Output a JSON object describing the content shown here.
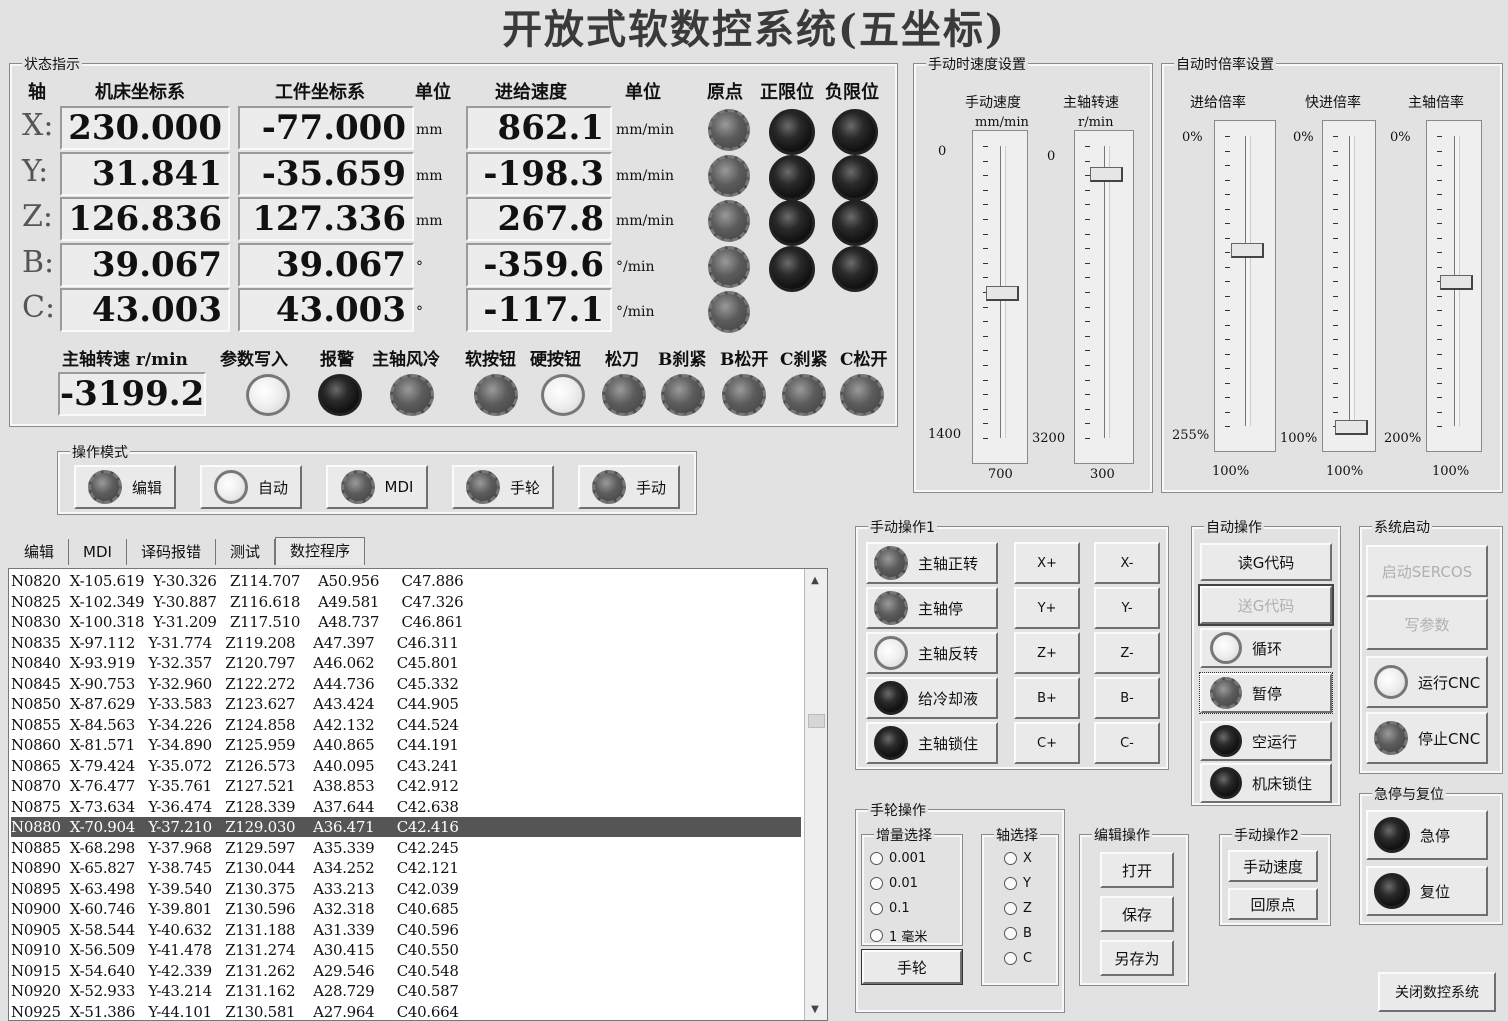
{
  "title": "开放式软数控系统(五坐标)",
  "status": {
    "legend": "状态指示",
    "headers": {
      "axis": "轴",
      "machine": "机床坐标系",
      "work": "工件坐标系",
      "unit1": "单位",
      "feed": "进给速度",
      "unit2": "单位",
      "origin": "原点",
      "pos_limit": "正限位",
      "neg_limit": "负限位"
    },
    "axes": [
      {
        "label": "X:",
        "machine": "230.000",
        "work": "-77.000",
        "unit": "mm",
        "feed": "862.1",
        "feed_unit": "mm/min"
      },
      {
        "label": "Y:",
        "machine": "31.841",
        "work": "-35.659",
        "unit": "mm",
        "feed": "-198.3",
        "feed_unit": "mm/min"
      },
      {
        "label": "Z:",
        "machine": "126.836",
        "work": "127.336",
        "unit": "mm",
        "feed": "267.8",
        "feed_unit": "mm/min"
      },
      {
        "label": "B:",
        "machine": "39.067",
        "work": "39.067",
        "unit": "°",
        "feed": "-359.6",
        "feed_unit": "°/min"
      },
      {
        "label": "C:",
        "machine": "43.003",
        "work": "43.003",
        "unit": "°",
        "feed": "-117.1",
        "feed_unit": "°/min"
      }
    ],
    "spindle_label": "主轴转速 r/min",
    "spindle_value": "-3199.2",
    "indicators": [
      "参数写入",
      "报警",
      "主轴风冷",
      "软按钮",
      "硬按钮",
      "松刀",
      "B刹紧",
      "B松开",
      "C刹紧",
      "C松开"
    ]
  },
  "mode": {
    "legend": "操作模式",
    "buttons": [
      "编辑",
      "自动",
      "MDI",
      "手轮",
      "手动"
    ]
  },
  "tabs": [
    "编辑",
    "MDI",
    "译码报错",
    "测试",
    "数控程序"
  ],
  "program": [
    "N0820  X-105.619  Y-30.326   Z114.707    A50.956     C47.886",
    "N0825  X-102.349  Y-30.887   Z116.618    A49.581     C47.326",
    "N0830  X-100.318  Y-31.209   Z117.510    A48.737     C46.861",
    "N0835  X-97.112   Y-31.774   Z119.208    A47.397     C46.311",
    "N0840  X-93.919   Y-32.357   Z120.797    A46.062     C45.801",
    "N0845  X-90.753   Y-32.960   Z122.272    A44.736     C45.332",
    "N0850  X-87.629   Y-33.583   Z123.627    A43.424     C44.905",
    "N0855  X-84.563   Y-34.226   Z124.858    A42.132     C44.524",
    "N0860  X-81.571   Y-34.890   Z125.959    A40.865     C44.191",
    "N0865  X-79.424   Y-35.072   Z126.573    A40.095     C43.241",
    "N0870  X-76.477   Y-35.761   Z127.521    A38.853     C42.912",
    "N0875  X-73.634   Y-36.474   Z128.339    A37.644     C42.638",
    "N0880  X-70.904   Y-37.210   Z129.030    A36.471     C42.416",
    "N0885  X-68.298   Y-37.968   Z129.597    A35.339     C42.245",
    "N0890  X-65.827   Y-38.745   Z130.044    A34.252     C42.121",
    "N0895  X-63.498   Y-39.540   Z130.375    A33.213     C42.039",
    "N0900  X-60.746   Y-39.801   Z130.596    A32.318     C40.685",
    "N0905  X-58.544   Y-40.632   Z131.188    A31.339     C40.596",
    "N0910  X-56.509   Y-41.478   Z131.274    A30.415     C40.550",
    "N0915  X-54.640   Y-42.339   Z131.262    A29.546     C40.548",
    "N0920  X-52.933   Y-43.214   Z131.162    A28.729     C40.587",
    "N0925  X-51.386   Y-44.101   Z130.581    A27.964     C40.664"
  ],
  "manual_speed": {
    "legend": "手动时速度设置",
    "speed_label": "手动速度",
    "speed_unit": "mm/min",
    "spindle_label": "主轴转速",
    "spindle_unit": "r/min",
    "speed_min": "0",
    "speed_max": "1400",
    "speed_value": "700",
    "spindle_min": "0",
    "spindle_max": "3200",
    "spindle_value": "300",
    "speed_level": 0.5,
    "spindle_level": 0.094
  },
  "auto_rate": {
    "legend": "自动时倍率设置",
    "feed_label": "进给倍率",
    "rapid_label": "快进倍率",
    "spindle_label": "主轴倍率",
    "feed_min": "0%",
    "feed_max": "255%",
    "feed_value": "100%",
    "rapid_min": "0%",
    "rapid_max": "100%",
    "rapid_value": "100%",
    "spindle_min": "0%",
    "spindle_max": "200%",
    "spindle_value": "100%",
    "feed_level": 0.39,
    "rapid_level": 1.0,
    "spindle_level": 0.5
  },
  "manual_op1": {
    "legend": "手动操作1",
    "buttons": [
      "主轴正转",
      "主轴停",
      "主轴反转",
      "给冷却液",
      "主轴锁住"
    ],
    "jog": [
      "X+",
      "X-",
      "Y+",
      "Y-",
      "Z+",
      "Z-",
      "B+",
      "B-",
      "C+",
      "C-"
    ]
  },
  "auto_op": {
    "legend": "自动操作",
    "read": "读G代码",
    "send": "送G代码",
    "cycle": "循环",
    "pause": "暂停",
    "dry_run": "空运行",
    "lock": "机床锁住"
  },
  "system": {
    "legend": "系统启动",
    "start_sercos": "启动SERCOS",
    "write_params": "写参数",
    "run": "运行CNC",
    "stop": "停止CNC"
  },
  "estop": {
    "legend": "急停与复位",
    "estop": "急停",
    "reset": "复位"
  },
  "handwheel": {
    "legend": "手轮操作",
    "inc_legend": "增量选择",
    "increments": [
      "0.001",
      "0.01",
      "0.1",
      "1 毫米"
    ],
    "axis_legend": "轴选择",
    "axes": [
      "X",
      "Y",
      "Z",
      "B",
      "C"
    ],
    "button": "手轮"
  },
  "edit_op": {
    "legend": "编辑操作",
    "open": "打开",
    "save": "保存",
    "save_as": "另存为"
  },
  "manual_op2": {
    "legend": "手动操作2",
    "speed": "手动速度",
    "home": "回原点"
  },
  "close": "关闭数控系统",
  "colors": {
    "bg": "#e2e2e2",
    "selected_row": "#555555"
  }
}
